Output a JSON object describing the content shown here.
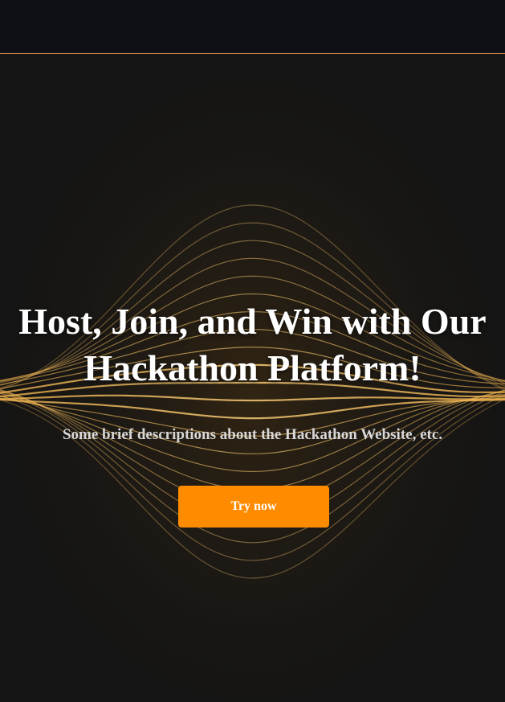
{
  "hero": {
    "headline_line1": "Host, Join, and Win with Our",
    "headline_line2": "Hackathon Platform!",
    "subtitle": "Some brief descriptions about the Hackathon Website, etc.",
    "cta_label": "Try now"
  },
  "colors": {
    "topbar_bg": "#0d1015",
    "topbar_border": "#c9834a",
    "page_bg": "#141414",
    "accent": "#ff8c00",
    "wave_gold": "#e0a03a"
  }
}
